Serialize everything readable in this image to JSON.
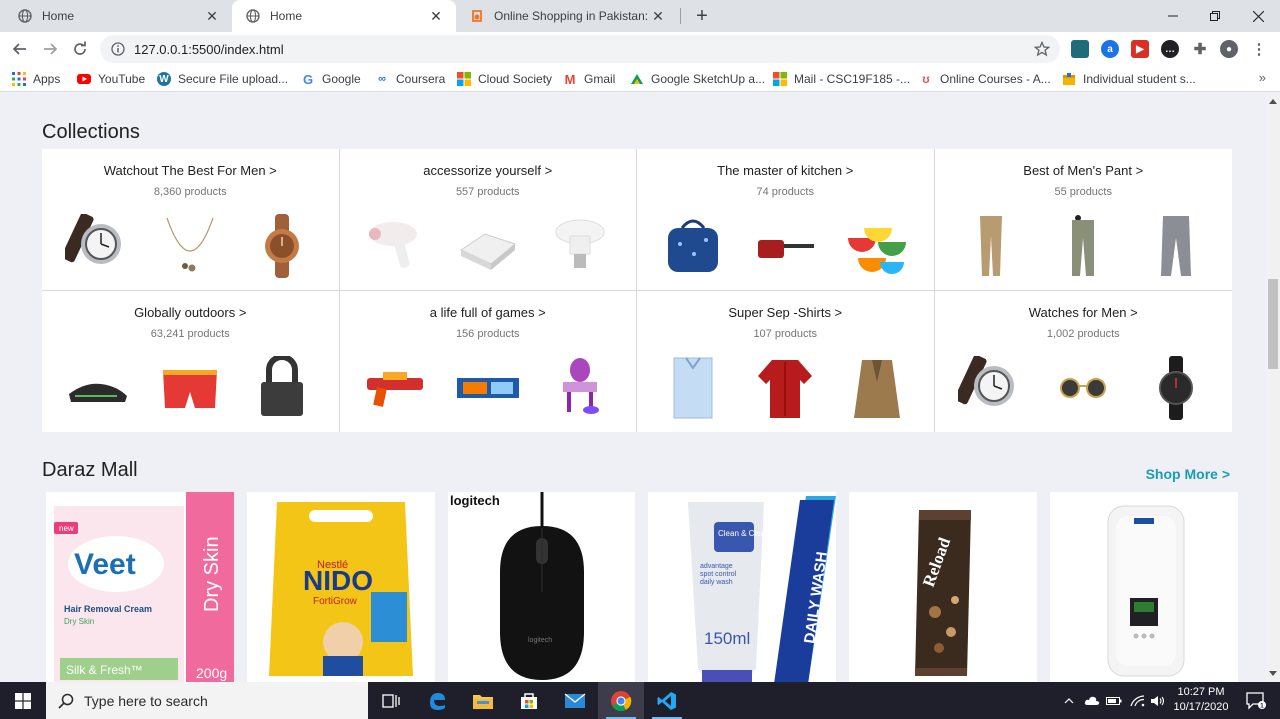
{
  "browser": {
    "tabs": [
      {
        "title": "Home",
        "favicon": "globe-icon",
        "active": false
      },
      {
        "title": "Home",
        "favicon": "globe-icon",
        "active": true
      },
      {
        "title": "Online Shopping in Pakistan: Fas",
        "favicon": "daraz-icon",
        "active": false
      }
    ],
    "url": "127.0.0.1:5500/index.html",
    "bookmarks": [
      {
        "label": "Apps",
        "icon": "apps-grid-icon"
      },
      {
        "label": "YouTube",
        "icon": "youtube-icon"
      },
      {
        "label": "Secure File upload...",
        "icon": "wordpress-icon"
      },
      {
        "label": "Google",
        "icon": "google-icon"
      },
      {
        "label": "Coursera",
        "icon": "coursera-icon"
      },
      {
        "label": "Cloud Society",
        "icon": "microsoft-icon"
      },
      {
        "label": "Gmail",
        "icon": "gmail-icon"
      },
      {
        "label": "Google SketchUp a...",
        "icon": "sketchup-icon"
      },
      {
        "label": "Mail - CSC19F185 -...",
        "icon": "microsoft-icon"
      },
      {
        "label": "Online Courses - A...",
        "icon": "udemy-icon"
      },
      {
        "label": "Individual student s...",
        "icon": "package-icon"
      }
    ],
    "bookmarks_overflow": "»"
  },
  "page": {
    "collections_title": "Collections",
    "collections": [
      {
        "name": "Watchout The Best For Men >",
        "count": "8,360 products",
        "thumbs": [
          "watch",
          "necklace",
          "wood-watch"
        ]
      },
      {
        "name": "accessorize yourself >",
        "count": "557 products",
        "thumbs": [
          "hair-dryer",
          "sandwich-maker",
          "bulb"
        ]
      },
      {
        "name": "The master of kitchen >",
        "count": "74 products",
        "thumbs": [
          "lunch-bag",
          "saucepan",
          "bowls"
        ]
      },
      {
        "name": "Best of Men's Pant >",
        "count": "55 products",
        "thumbs": [
          "khaki-pant",
          "cargo-pant",
          "grey-pant"
        ]
      },
      {
        "name": "Globally outdoors >",
        "count": "63,241 products",
        "thumbs": [
          "shoe",
          "swim-shorts",
          "padlock"
        ]
      },
      {
        "name": "a life full of games >",
        "count": "156 products",
        "thumbs": [
          "nerf-gun",
          "toy-box",
          "vanity-toy"
        ]
      },
      {
        "name": "Super Sep -Shirts >",
        "count": "107 products",
        "thumbs": [
          "blue-shirt",
          "red-shirt",
          "coat"
        ]
      },
      {
        "name": "Watches for Men >",
        "count": "1,002 products",
        "thumbs": [
          "watch",
          "sunglasses",
          "black-watch"
        ]
      }
    ],
    "mall_title": "Daraz Mall",
    "shop_more": "Shop More >",
    "mall_items": [
      {
        "name": "veet-product",
        "brand": "Veet",
        "lines": [
          "Hair Removal Cream",
          "Dry Skin",
          "Silk & Fresh™"
        ],
        "side": "Dry Skin",
        "size": "200g",
        "badge": "new"
      },
      {
        "name": "nido-product",
        "brand": "NIDO",
        "lines": [
          "Nestlé",
          "FortiGrow"
        ]
      },
      {
        "name": "logitech-mouse",
        "brand": "logitech",
        "lines": [
          "logitech"
        ]
      },
      {
        "name": "clean-clear-wash",
        "brand": "Clean & Clear",
        "lines": [
          "advantage",
          "spot control",
          "daily wash",
          "150ml"
        ],
        "side": "DAILY WASH"
      },
      {
        "name": "reload-bar",
        "brand": "Reload",
        "lines": []
      },
      {
        "name": "white-device",
        "brand": "",
        "lines": []
      }
    ]
  },
  "taskbar": {
    "search_placeholder": "Type here to search",
    "time": "10:27 PM",
    "date": "10/17/2020",
    "notification_count": "1"
  },
  "colors": {
    "accent": "#1a9cb7",
    "page_bg": "#eff0f5",
    "taskbar_bg": "#1f1f2b"
  }
}
